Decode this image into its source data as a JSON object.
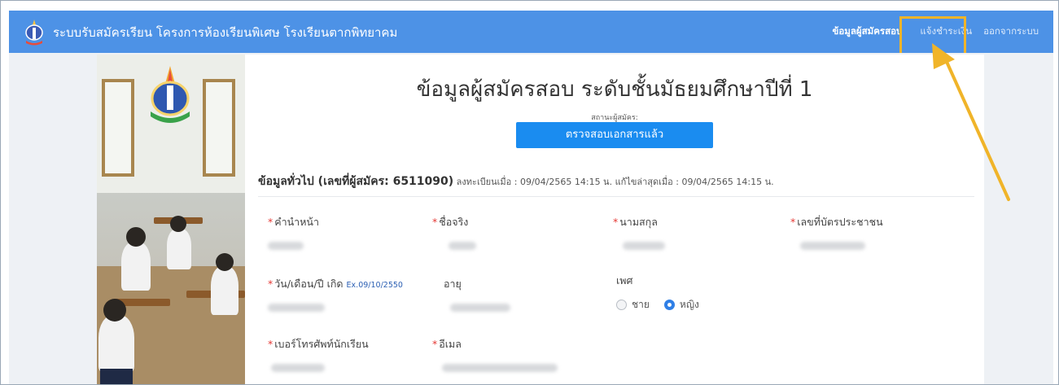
{
  "navbar": {
    "title": "ระบบรับสมัครเรียน โครงการห้องเรียนพิเศษ โรงเรียนตากพิทยาคม",
    "links": [
      {
        "label": "ข้อมูลผู้สมัครสอบ"
      },
      {
        "label": "แจ้งชำระเงิน"
      },
      {
        "label": "ออกจากระบบ"
      }
    ],
    "colors": {
      "bar": "#4d92e6",
      "highlight": "#f0b429"
    }
  },
  "main": {
    "title": "ข้อมูลผู้สมัครสอบ ระดับชั้นมัธยมศึกษาปีที่ 1",
    "status_label": "สถานะผู้สมัคร:",
    "status_button": "ตรวจสอบเอกสารแล้ว",
    "section": {
      "heading": "ข้อมูลทั่วไป (เลขที่ผู้สมัคร: 6511090)",
      "registered": "ลงทะเบียนเมื่อ : 09/04/2565 14:15 น.",
      "modified": "แก้ไขล่าสุดเมื่อ : 09/04/2565 14:15 น."
    },
    "fields": {
      "prefix": "คำนำหน้า",
      "first_name": "ชื่อจริง",
      "last_name": "นามสกุล",
      "id_card": "เลขที่บัตรประชาชน",
      "birthdate": "วัน/เดือน/ปี เกิด",
      "birthdate_hint": "Ex.09/10/2550",
      "age": "อายุ",
      "gender": "เพศ",
      "gender_male": "ชาย",
      "gender_female": "หญิง",
      "phone": "เบอร์โทรศัพท์นักเรียน",
      "email": "อีเมล"
    }
  }
}
